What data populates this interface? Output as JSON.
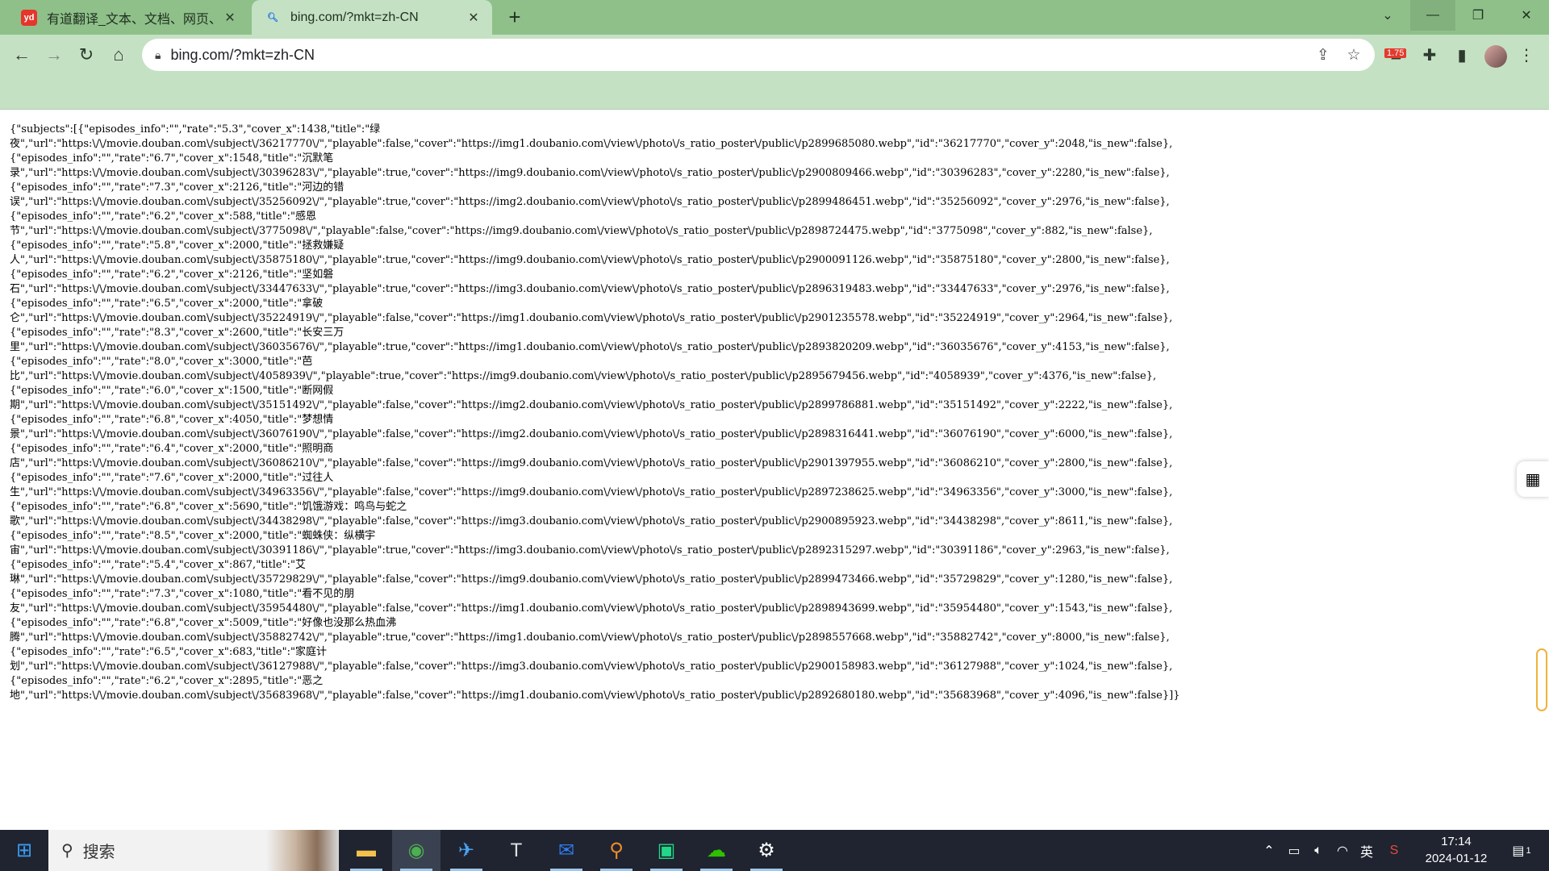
{
  "browser": {
    "tabs": [
      {
        "title": "有道翻译_文本、文档、网页、在",
        "favicon": "yd",
        "active": false
      },
      {
        "title": "bing.com/?mkt=zh-CN",
        "favicon": "search",
        "active": true
      }
    ],
    "address": "bing.com/?mkt=zh-CN",
    "extension_badge": "1.75"
  },
  "page": {
    "json_lines": [
      "{\"subjects\":[{\"episodes_info\":\"\",\"rate\":\"5.3\",\"cover_x\":1438,\"title\":\"绿",
      "夜\",\"url\":\"https:\\/\\/movie.douban.com\\/subject\\/36217770\\/\",\"playable\":false,\"cover\":\"https://img1.doubanio.com\\/view\\/photo\\/s_ratio_poster\\/public\\/p2899685080.webp\",\"id\":\"36217770\",\"cover_y\":2048,\"is_new\":false},",
      "{\"episodes_info\":\"\",\"rate\":\"6.7\",\"cover_x\":1548,\"title\":\"沉默笔",
      "录\",\"url\":\"https:\\/\\/movie.douban.com\\/subject\\/30396283\\/\",\"playable\":true,\"cover\":\"https://img9.doubanio.com\\/view\\/photo\\/s_ratio_poster\\/public\\/p2900809466.webp\",\"id\":\"30396283\",\"cover_y\":2280,\"is_new\":false},",
      "{\"episodes_info\":\"\",\"rate\":\"7.3\",\"cover_x\":2126,\"title\":\"河边的错",
      "误\",\"url\":\"https:\\/\\/movie.douban.com\\/subject\\/35256092\\/\",\"playable\":true,\"cover\":\"https://img2.doubanio.com\\/view\\/photo\\/s_ratio_poster\\/public\\/p2899486451.webp\",\"id\":\"35256092\",\"cover_y\":2976,\"is_new\":false},",
      "{\"episodes_info\":\"\",\"rate\":\"6.2\",\"cover_x\":588,\"title\":\"感恩",
      "节\",\"url\":\"https:\\/\\/movie.douban.com\\/subject\\/3775098\\/\",\"playable\":false,\"cover\":\"https://img9.doubanio.com\\/view\\/photo\\/s_ratio_poster\\/public\\/p2898724475.webp\",\"id\":\"3775098\",\"cover_y\":882,\"is_new\":false},",
      "{\"episodes_info\":\"\",\"rate\":\"5.8\",\"cover_x\":2000,\"title\":\"拯救嫌疑",
      "人\",\"url\":\"https:\\/\\/movie.douban.com\\/subject\\/35875180\\/\",\"playable\":true,\"cover\":\"https://img9.doubanio.com\\/view\\/photo\\/s_ratio_poster\\/public\\/p2900091126.webp\",\"id\":\"35875180\",\"cover_y\":2800,\"is_new\":false},",
      "{\"episodes_info\":\"\",\"rate\":\"6.2\",\"cover_x\":2126,\"title\":\"坚如磐",
      "石\",\"url\":\"https:\\/\\/movie.douban.com\\/subject\\/33447633\\/\",\"playable\":true,\"cover\":\"https://img3.doubanio.com\\/view\\/photo\\/s_ratio_poster\\/public\\/p2896319483.webp\",\"id\":\"33447633\",\"cover_y\":2976,\"is_new\":false},",
      "{\"episodes_info\":\"\",\"rate\":\"6.5\",\"cover_x\":2000,\"title\":\"拿破",
      "仑\",\"url\":\"https:\\/\\/movie.douban.com\\/subject\\/35224919\\/\",\"playable\":false,\"cover\":\"https://img1.doubanio.com\\/view\\/photo\\/s_ratio_poster\\/public\\/p2901235578.webp\",\"id\":\"35224919\",\"cover_y\":2964,\"is_new\":false},",
      "{\"episodes_info\":\"\",\"rate\":\"8.3\",\"cover_x\":2600,\"title\":\"长安三万",
      "里\",\"url\":\"https:\\/\\/movie.douban.com\\/subject\\/36035676\\/\",\"playable\":true,\"cover\":\"https://img1.doubanio.com\\/view\\/photo\\/s_ratio_poster\\/public\\/p2893820209.webp\",\"id\":\"36035676\",\"cover_y\":4153,\"is_new\":false},",
      "{\"episodes_info\":\"\",\"rate\":\"8.0\",\"cover_x\":3000,\"title\":\"芭",
      "比\",\"url\":\"https:\\/\\/movie.douban.com\\/subject\\/4058939\\/\",\"playable\":true,\"cover\":\"https://img9.doubanio.com\\/view\\/photo\\/s_ratio_poster\\/public\\/p2895679456.webp\",\"id\":\"4058939\",\"cover_y\":4376,\"is_new\":false},",
      "{\"episodes_info\":\"\",\"rate\":\"6.0\",\"cover_x\":1500,\"title\":\"断网假",
      "期\",\"url\":\"https:\\/\\/movie.douban.com\\/subject\\/35151492\\/\",\"playable\":false,\"cover\":\"https://img2.doubanio.com\\/view\\/photo\\/s_ratio_poster\\/public\\/p2899786881.webp\",\"id\":\"35151492\",\"cover_y\":2222,\"is_new\":false},",
      "{\"episodes_info\":\"\",\"rate\":\"6.8\",\"cover_x\":4050,\"title\":\"梦想情",
      "景\",\"url\":\"https:\\/\\/movie.douban.com\\/subject\\/36076190\\/\",\"playable\":false,\"cover\":\"https://img2.doubanio.com\\/view\\/photo\\/s_ratio_poster\\/public\\/p2898316441.webp\",\"id\":\"36076190\",\"cover_y\":6000,\"is_new\":false},",
      "{\"episodes_info\":\"\",\"rate\":\"6.4\",\"cover_x\":2000,\"title\":\"照明商",
      "店\",\"url\":\"https:\\/\\/movie.douban.com\\/subject\\/36086210\\/\",\"playable\":false,\"cover\":\"https://img9.doubanio.com\\/view\\/photo\\/s_ratio_poster\\/public\\/p2901397955.webp\",\"id\":\"36086210\",\"cover_y\":2800,\"is_new\":false},",
      "{\"episodes_info\":\"\",\"rate\":\"7.6\",\"cover_x\":2000,\"title\":\"过往人",
      "生\",\"url\":\"https:\\/\\/movie.douban.com\\/subject\\/34963356\\/\",\"playable\":false,\"cover\":\"https://img9.doubanio.com\\/view\\/photo\\/s_ratio_poster\\/public\\/p2897238625.webp\",\"id\":\"34963356\",\"cover_y\":3000,\"is_new\":false},",
      "{\"episodes_info\":\"\",\"rate\":\"6.8\",\"cover_x\":5690,\"title\":\"饥饿游戏：鸣鸟与蛇之",
      "歌\",\"url\":\"https:\\/\\/movie.douban.com\\/subject\\/34438298\\/\",\"playable\":false,\"cover\":\"https://img3.doubanio.com\\/view\\/photo\\/s_ratio_poster\\/public\\/p2900895923.webp\",\"id\":\"34438298\",\"cover_y\":8611,\"is_new\":false},",
      "{\"episodes_info\":\"\",\"rate\":\"8.5\",\"cover_x\":2000,\"title\":\"蜘蛛侠：纵横宇",
      "宙\",\"url\":\"https:\\/\\/movie.douban.com\\/subject\\/30391186\\/\",\"playable\":true,\"cover\":\"https://img3.doubanio.com\\/view\\/photo\\/s_ratio_poster\\/public\\/p2892315297.webp\",\"id\":\"30391186\",\"cover_y\":2963,\"is_new\":false},",
      "{\"episodes_info\":\"\",\"rate\":\"5.4\",\"cover_x\":867,\"title\":\"艾",
      "琳\",\"url\":\"https:\\/\\/movie.douban.com\\/subject\\/35729829\\/\",\"playable\":false,\"cover\":\"https://img9.doubanio.com\\/view\\/photo\\/s_ratio_poster\\/public\\/p2899473466.webp\",\"id\":\"35729829\",\"cover_y\":1280,\"is_new\":false},",
      "{\"episodes_info\":\"\",\"rate\":\"7.3\",\"cover_x\":1080,\"title\":\"看不见的朋",
      "友\",\"url\":\"https:\\/\\/movie.douban.com\\/subject\\/35954480\\/\",\"playable\":false,\"cover\":\"https://img1.doubanio.com\\/view\\/photo\\/s_ratio_poster\\/public\\/p2898943699.webp\",\"id\":\"35954480\",\"cover_y\":1543,\"is_new\":false},",
      "{\"episodes_info\":\"\",\"rate\":\"6.8\",\"cover_x\":5009,\"title\":\"好像也没那么热血沸",
      "腾\",\"url\":\"https:\\/\\/movie.douban.com\\/subject\\/35882742\\/\",\"playable\":true,\"cover\":\"https://img1.doubanio.com\\/view\\/photo\\/s_ratio_poster\\/public\\/p2898557668.webp\",\"id\":\"35882742\",\"cover_y\":8000,\"is_new\":false},",
      "{\"episodes_info\":\"\",\"rate\":\"6.5\",\"cover_x\":683,\"title\":\"家庭计",
      "划\",\"url\":\"https:\\/\\/movie.douban.com\\/subject\\/36127988\\/\",\"playable\":false,\"cover\":\"https://img3.doubanio.com\\/view\\/photo\\/s_ratio_poster\\/public\\/p2900158983.webp\",\"id\":\"36127988\",\"cover_y\":1024,\"is_new\":false},",
      "{\"episodes_info\":\"\",\"rate\":\"6.2\",\"cover_x\":2895,\"title\":\"恶之",
      "地\",\"url\":\"https:\\/\\/movie.douban.com\\/subject\\/35683968\\/\",\"playable\":false,\"cover\":\"https://img1.doubanio.com\\/view\\/photo\\/s_ratio_poster\\/public\\/p2892680180.webp\",\"id\":\"35683968\",\"cover_y\":4096,\"is_new\":false}]}"
    ]
  },
  "taskbar": {
    "search_placeholder": "搜索",
    "ime": "英",
    "time": "17:14",
    "date": "2024-01-12",
    "notification_count": "1"
  },
  "colors": {
    "titlebar": "#8fc08a",
    "toolbar": "#c5e1c4",
    "taskbar": "#1f2430"
  }
}
